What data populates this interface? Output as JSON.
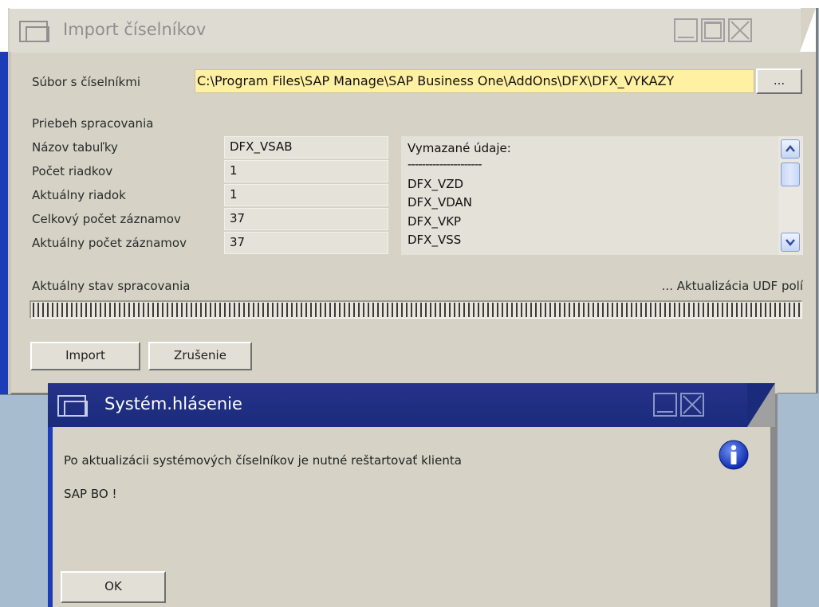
{
  "main_window": {
    "title": "Import číselníkov",
    "file_label": "Súbor s číselníkmi",
    "file_path": "C:\\Program Files\\SAP Manage\\SAP Business One\\AddOns\\DFX\\DFX_VYKAZY",
    "browse_label": "...",
    "section_label": "Priebeh spracovania",
    "fields": [
      {
        "label": "Názov tabuľky",
        "value": "DFX_VSAB"
      },
      {
        "label": "Počet riadkov",
        "value": "1"
      },
      {
        "label": "Aktuálny riadok",
        "value": "1"
      },
      {
        "label": "Celkový počet záznamov",
        "value": "37"
      },
      {
        "label": "Aktuálny počet záznamov",
        "value": "37"
      }
    ],
    "log": {
      "header": "Vymazané údaje:",
      "separator": "---------------------",
      "lines": [
        "DFX_VZD",
        "DFX_VDAN",
        "DFX_VKP",
        "DFX_VSS"
      ]
    },
    "status_label": "Aktuálny stav spracovania",
    "status_value": "... Aktualizácia UDF polí",
    "progress_percent": 100,
    "import_button": "Import",
    "cancel_button": "Zrušenie"
  },
  "dialog": {
    "title": "Systém.hlásenie",
    "message_line1": "Po aktualizácii systémových číselníkov je nutné reštartovať klienta",
    "message_line2": "SAP BO !",
    "ok_button": "OK"
  },
  "icons": {
    "window": "window-icon",
    "minimize": "minimize-icon",
    "maximize": "maximize-icon",
    "close": "close-icon",
    "info": "info-icon",
    "scroll_up": "chevron-up-icon",
    "scroll_down": "chevron-down-icon"
  },
  "colors": {
    "desktop": "#a7bccf",
    "window_bg": "#d6d3c6",
    "accent_blue": "#1d3cb8",
    "dialog_title": "#1a2b7b",
    "path_highlight": "#fff0a2"
  }
}
